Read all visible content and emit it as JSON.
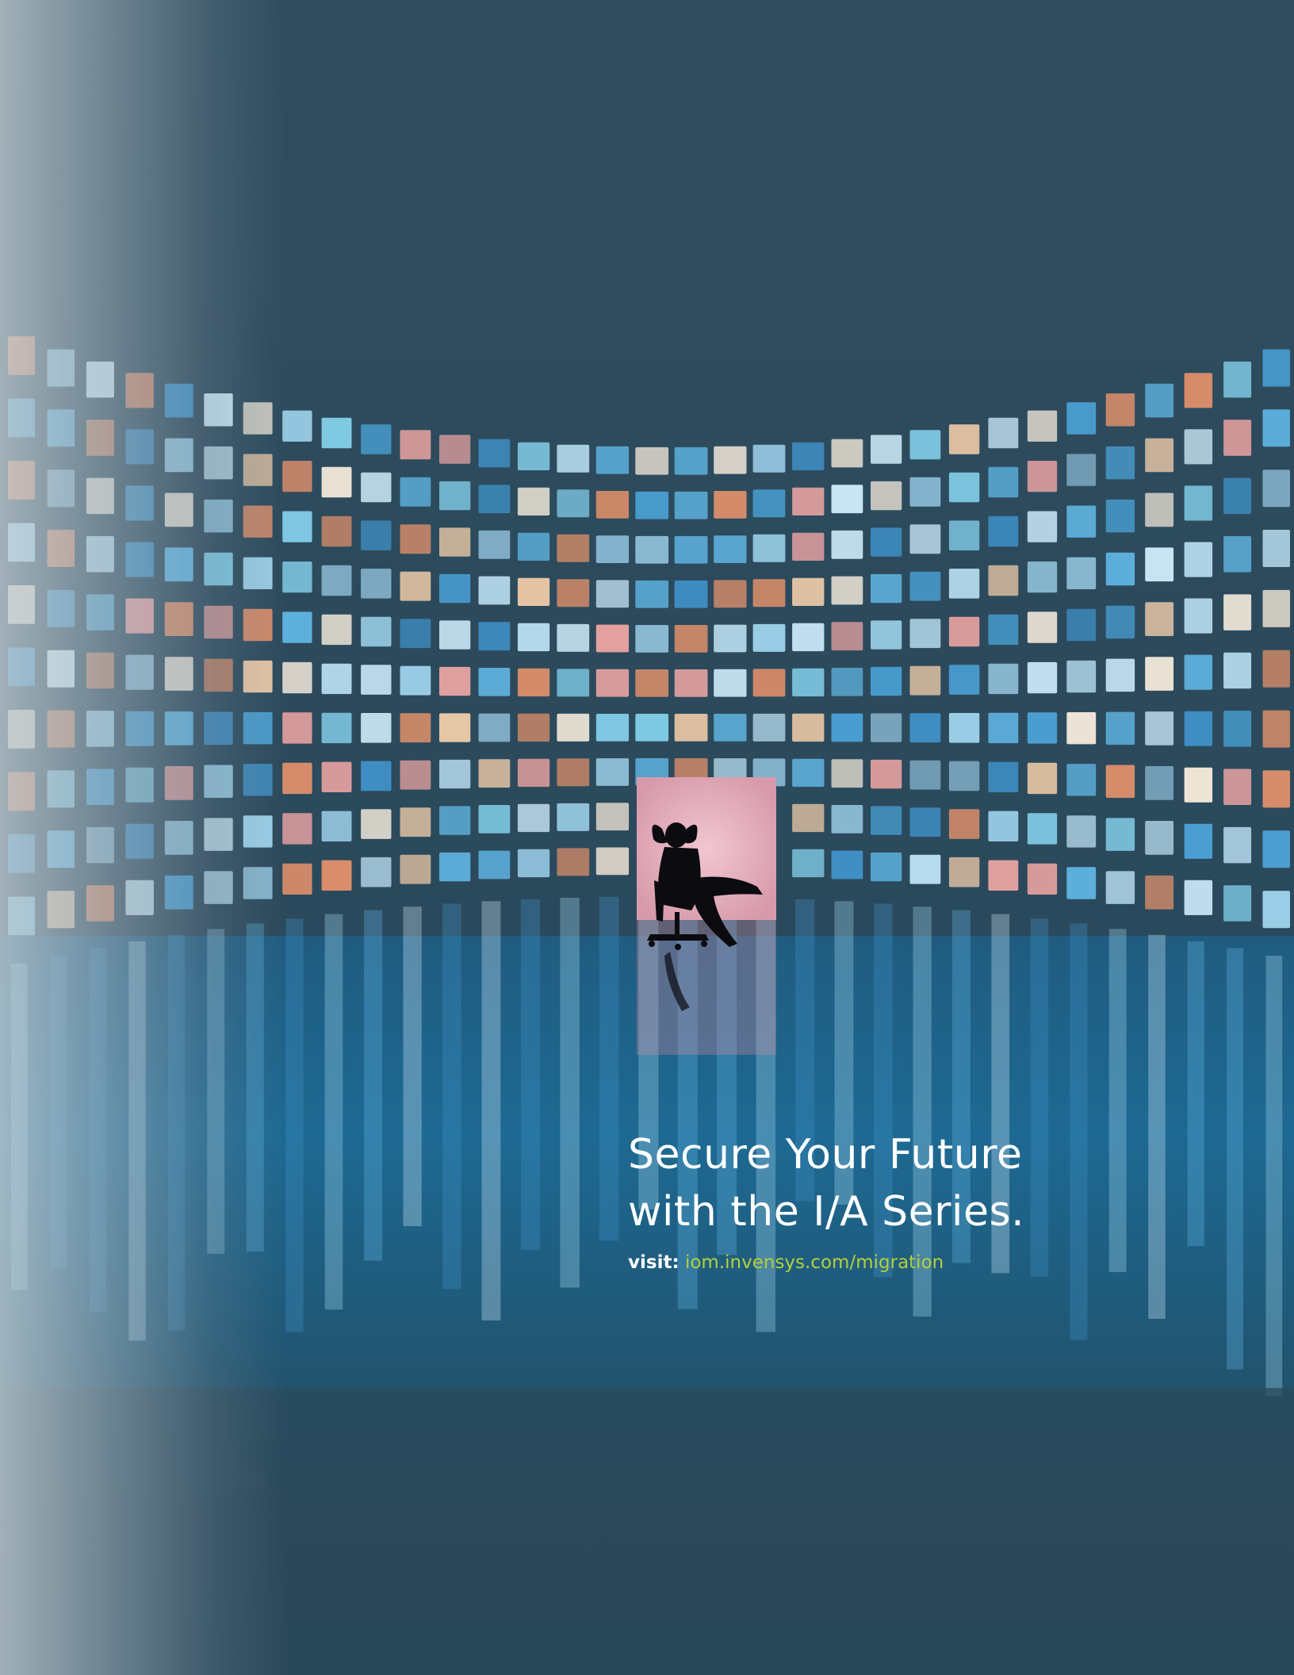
{
  "ad": {
    "headline_line1": "Secure Your Future",
    "headline_line2": "with the I/A Series.",
    "visit_prefix": "visit:",
    "visit_url": "iom.invensys.com/migration"
  },
  "colors": {
    "background": "#2b4a5b",
    "headline_text": "#ffffff",
    "url_accent": "#b5cf3b",
    "door_glow": "#e7b7c3"
  }
}
